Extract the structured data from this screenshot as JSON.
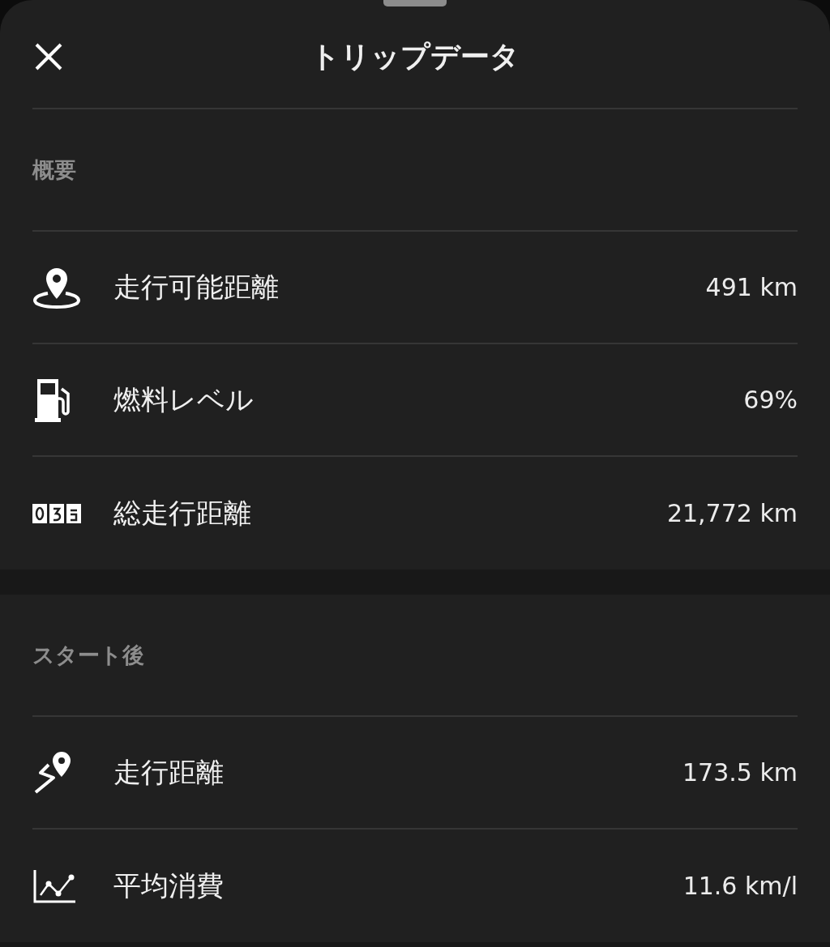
{
  "header": {
    "title": "トリップデータ"
  },
  "sections": [
    {
      "label": "概要",
      "rows": [
        {
          "kind": "range",
          "label": "走行可能距離",
          "value": "491 km"
        },
        {
          "kind": "fuel",
          "label": "燃料レベル",
          "value": "69%"
        },
        {
          "kind": "odometer",
          "label": "総走行距離",
          "value": "21,772 km"
        }
      ]
    },
    {
      "label": "スタート後",
      "rows": [
        {
          "kind": "trip",
          "label": "走行距離",
          "value": "173.5 km"
        },
        {
          "kind": "consumption",
          "label": "平均消費",
          "value": "11.6 km/l"
        }
      ]
    }
  ]
}
